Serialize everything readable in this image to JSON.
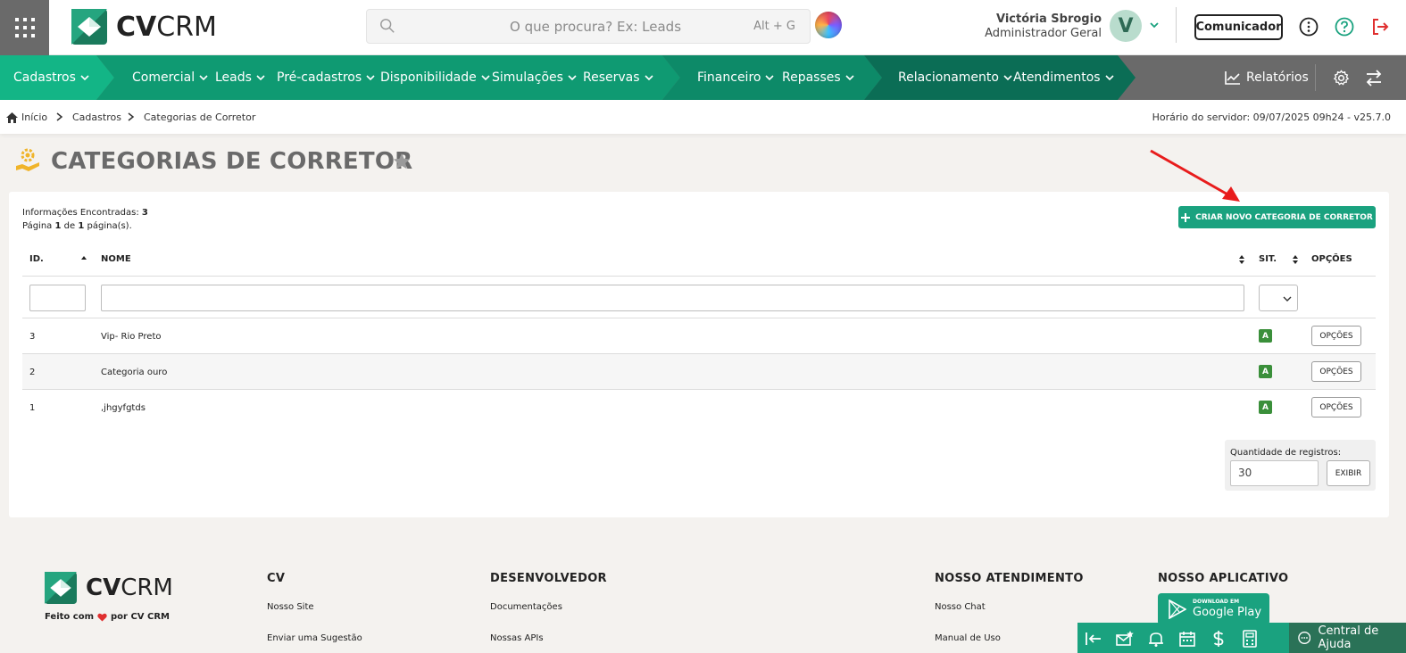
{
  "header": {
    "logo_bold": "CV",
    "logo_light": "CRM",
    "search_placeholder": "O que procura? Ex: Leads",
    "search_shortcut": "Alt + G",
    "user_name": "Victória Sbrogio",
    "user_role": "Administrador Geral",
    "avatar_initial": "V",
    "communicator_label": "Comunicador",
    "icons": [
      "grid-menu-icon",
      "search-icon",
      "ai-assistant-icon",
      "chevron-down-icon",
      "more-vertical-icon",
      "help-circle-icon",
      "logout-icon"
    ]
  },
  "nav": {
    "items": [
      {
        "label": "Cadastros"
      },
      {
        "label": "Comercial"
      },
      {
        "label": "Leads"
      },
      {
        "label": "Pré-cadastros"
      },
      {
        "label": "Disponibilidade"
      },
      {
        "label": "Simulações"
      },
      {
        "label": "Reservas"
      },
      {
        "label": "Financeiro"
      },
      {
        "label": "Repasses"
      },
      {
        "label": "Relacionamento"
      },
      {
        "label": "Atendimentos"
      }
    ],
    "reports_label": "Relatórios",
    "colors": {
      "gray": "#6a6a6a",
      "green_light": "#13b586",
      "green": "#0f9a72",
      "green_mid": "#0d8a68",
      "green_dark": "#0b6d55"
    }
  },
  "breadcrumb": {
    "items": [
      "Início",
      "Cadastros",
      "Categorias de Corretor"
    ],
    "server_time": "Horário do servidor: 09/07/2025 09h24 - v25.7.0"
  },
  "page": {
    "title": "CATEGORIAS DE CORRETOR"
  },
  "list": {
    "found_label": "Informações Encontradas:",
    "found_count": "3",
    "page_word": "Página",
    "page_current": "1",
    "page_of": "de",
    "page_total": "1",
    "page_suffix": "página(s).",
    "create_button": "CRIAR NOVO CATEGORIA DE CORRETOR",
    "columns": {
      "id": "ID.",
      "name": "NOME",
      "status": "SIT.",
      "options": "OPÇÕES"
    },
    "rows": [
      {
        "id": "3",
        "name": "Vip- Rio Preto",
        "status": "A",
        "options": "OPÇÕES"
      },
      {
        "id": "2",
        "name": "Categoria ouro",
        "status": "A",
        "options": "OPÇÕES"
      },
      {
        "id": "1",
        "name": ",jhgyfgtds",
        "status": "A",
        "options": "OPÇÕES"
      }
    ],
    "quantity_label": "Quantidade de registros:",
    "quantity_value": "30",
    "show_button": "EXIBIR",
    "accent": "#1aa27f",
    "status_color": "#3a8f3a"
  },
  "footer": {
    "made_with_prefix": "Feito com",
    "made_with_suffix": "por CV CRM",
    "columns": [
      {
        "title": "CV",
        "links": [
          "Nosso Site",
          "Enviar uma Sugestão"
        ]
      },
      {
        "title": "DESENVOLVEDOR",
        "links": [
          "Documentações",
          "Nossas APIs"
        ]
      },
      {
        "title": "NOSSO ATENDIMENTO",
        "links": [
          "Nosso Chat",
          "Manual de Uso"
        ]
      },
      {
        "title": "NOSSO APLICATIVO",
        "links": []
      }
    ],
    "gplay_small": "DOWNLOAD EM",
    "gplay_big": "Google Play",
    "help_label": "Central de Ajuda"
  }
}
